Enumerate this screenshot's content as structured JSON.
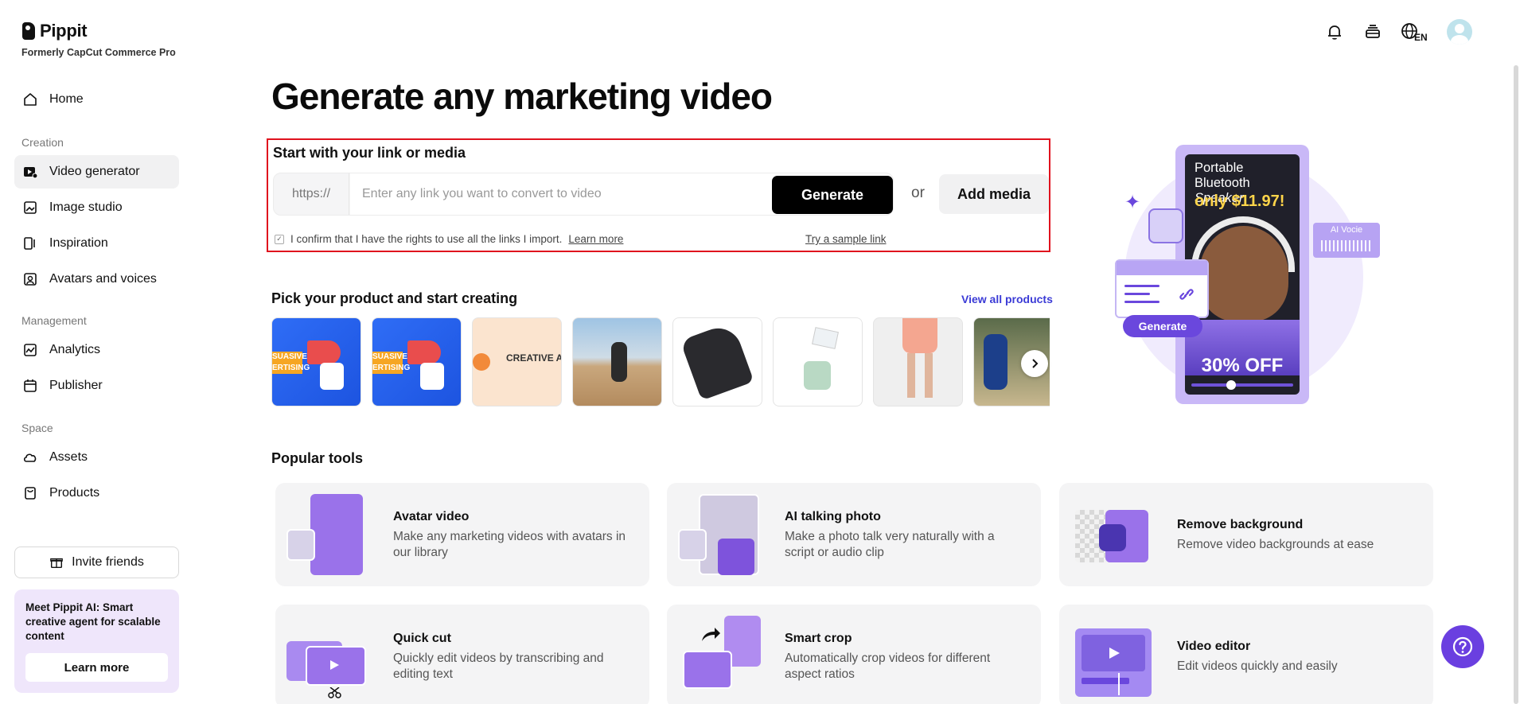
{
  "brand": {
    "name": "Pippit",
    "subtitle": "Formerly CapCut Commerce Pro"
  },
  "sidebar": {
    "items": [
      {
        "label": "Home",
        "icon": "home-icon"
      },
      {
        "label": "Video generator",
        "icon": "video-generator-icon",
        "active": true
      },
      {
        "label": "Image studio",
        "icon": "image-studio-icon"
      },
      {
        "label": "Inspiration",
        "icon": "inspiration-icon"
      },
      {
        "label": "Avatars and voices",
        "icon": "avatar-voice-icon"
      },
      {
        "label": "Analytics",
        "icon": "analytics-icon"
      },
      {
        "label": "Publisher",
        "icon": "calendar-icon"
      },
      {
        "label": "Assets",
        "icon": "cloud-icon"
      },
      {
        "label": "Products",
        "icon": "product-box-icon"
      }
    ],
    "sections": {
      "creation": "Creation",
      "management": "Management",
      "space": "Space"
    },
    "invite_label": "Invite friends",
    "promo_text": "Meet Pippit AI: Smart creative agent for scalable content",
    "promo_button": "Learn more"
  },
  "header": {
    "language_badge": "EN"
  },
  "main": {
    "title": "Generate any marketing video",
    "link_section": {
      "heading": "Start with your link or media",
      "url_prefix": "https://",
      "url_placeholder": "Enter any link you want to convert to video",
      "url_value": "",
      "generate_label": "Generate",
      "or_label": "or",
      "add_media_label": "Add media",
      "confirm_text": "I confirm that I have the rights to use all the links I import.",
      "learn_more": "Learn more",
      "sample_link": "Try a sample link",
      "confirm_checked": true
    },
    "products": {
      "heading": "Pick your product and start creating",
      "view_all": "View all products",
      "thumb_texts": [
        "SUASIVE ERTISING",
        "SUASIVE ERTISING",
        "CREATIVE AUTOMAT"
      ]
    },
    "hero": {
      "phone_title_line1": "Portable",
      "phone_title_line2": "Bluetooth",
      "phone_title_italic": "Speaker",
      "price": "only $11.97!",
      "discount": "30% OFF",
      "ai_voice": "AI Vocie",
      "generate": "Generate"
    },
    "tools": {
      "heading": "Popular tools",
      "items": [
        {
          "title": "Avatar video",
          "desc": "Make any marketing videos with avatars in our library"
        },
        {
          "title": "AI talking photo",
          "desc": "Make a photo talk very naturally with a script or audio clip"
        },
        {
          "title": "Remove background",
          "desc": "Remove video backgrounds at ease"
        },
        {
          "title": "Quick cut",
          "desc": "Quickly edit videos by transcribing and editing text"
        },
        {
          "title": "Smart crop",
          "desc": "Automatically crop videos for different aspect ratios"
        },
        {
          "title": "Video editor",
          "desc": "Edit videos quickly and easily"
        }
      ]
    }
  },
  "colors": {
    "accent": "#6a3fe0",
    "highlight_border": "#e0121e",
    "link_blue": "#3b3bd6"
  }
}
